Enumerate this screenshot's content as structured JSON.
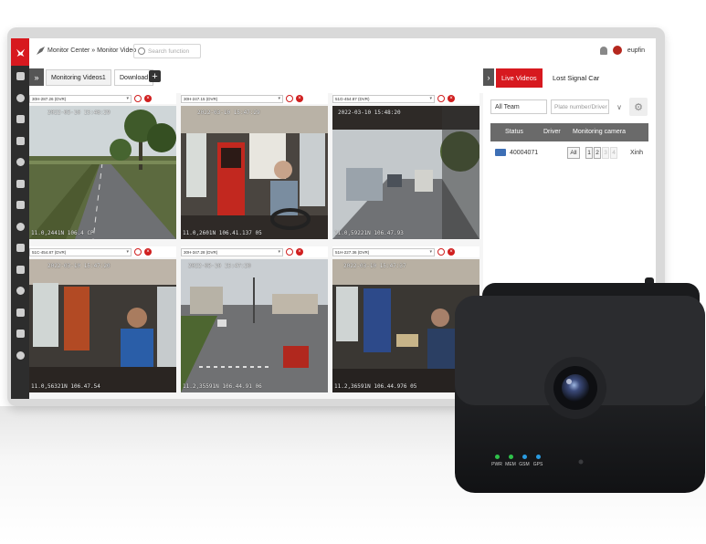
{
  "colors": {
    "brand": "#d7191f",
    "sidebar": "#2d2d2d",
    "table_header": "#6a6a6a"
  },
  "sidebar": {
    "icons": [
      "map-pin-icon",
      "shield-icon",
      "route-icon",
      "road-icon",
      "chart-icon",
      "truck-icon",
      "alarm-icon",
      "user-icon",
      "group-icon",
      "briefcase-icon",
      "fuel-icon",
      "settings-icon",
      "gps-icon",
      "apps-icon"
    ]
  },
  "header": {
    "breadcrumb": "Monitor Center » Monitor Video",
    "search_placeholder": "Search function",
    "username": "eupfin"
  },
  "tabs": {
    "monitoring": "Monitoring Videos1",
    "download": "Download",
    "add": "+"
  },
  "cells": [
    {
      "channel": "30H-287.26 (DVR)",
      "osd_top": "2022-03-10 15:48:29",
      "osd_bottom": "11.0,2441N 106.4 CP"
    },
    {
      "channel": "30H-247.15 (DVR)",
      "osd_top": "2022-03-10 15:47:29",
      "osd_bottom": "11.0,2601N 106.41.137 05"
    },
    {
      "channel": "51G-454.87 (DVR)",
      "osd_top": "2022-03-10 15:48:20",
      "osd_bottom": "11.0,59221N 106.47.93"
    },
    {
      "channel": "51C-454.87 (DVR)",
      "osd_top": "2022-03-10 15:47:20",
      "osd_bottom": "11.0,56321N 106.47.54"
    },
    {
      "channel": "30H-347.28 (DVR)",
      "osd_top": "2022-03-10 15:47:20",
      "osd_bottom": "11.2,35591N 106.44.91 06"
    },
    {
      "channel": "51H-227.36 (DVR)",
      "osd_top": "2022-03-10 15:47:37",
      "osd_bottom": "11.2,36591N 106.44.976 05"
    }
  ],
  "right": {
    "live_tab": "Live Videos",
    "lost_tab": "Lost Signal Car",
    "team": "All Team",
    "plate_placeholder": "Plate number/Driver",
    "cols": {
      "status": "Status",
      "driver": "Driver",
      "camera": "Monitoring camera"
    },
    "row": {
      "plate": "40004071",
      "all": "All",
      "c1": "1",
      "c2": "2",
      "c3": "3",
      "c4": "4",
      "extra": "Xinh"
    }
  },
  "device": {
    "leds": [
      "PWR",
      "MEM",
      "GSM",
      "GPS"
    ],
    "led_colors": [
      "#2fc14a",
      "#2fc14a",
      "#2a9be0",
      "#2a9be0"
    ]
  }
}
